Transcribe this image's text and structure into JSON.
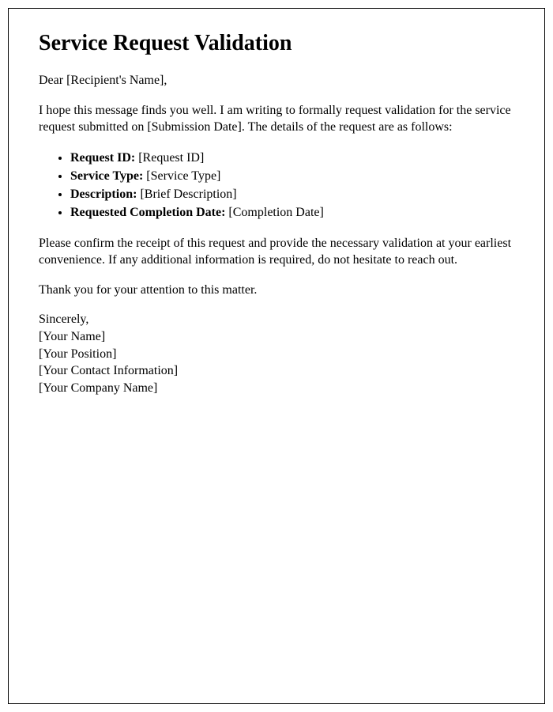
{
  "title": "Service Request Validation",
  "greeting": "Dear [Recipient's Name],",
  "intro": "I hope this message finds you well. I am writing to formally request validation for the service request submitted on [Submission Date]. The details of the request are as follows:",
  "details": [
    {
      "label": "Request ID:",
      "value": " [Request ID]"
    },
    {
      "label": "Service Type:",
      "value": " [Service Type]"
    },
    {
      "label": "Description:",
      "value": " [Brief Description]"
    },
    {
      "label": "Requested Completion Date:",
      "value": " [Completion Date]"
    }
  ],
  "confirmation": "Please confirm the receipt of this request and provide the necessary validation at your earliest convenience. If any additional information is required, do not hesitate to reach out.",
  "thanks": "Thank you for your attention to this matter.",
  "closing": "Sincerely,",
  "signature": {
    "name": "[Your Name]",
    "position": "[Your Position]",
    "contact": "[Your Contact Information]",
    "company": "[Your Company Name]"
  }
}
